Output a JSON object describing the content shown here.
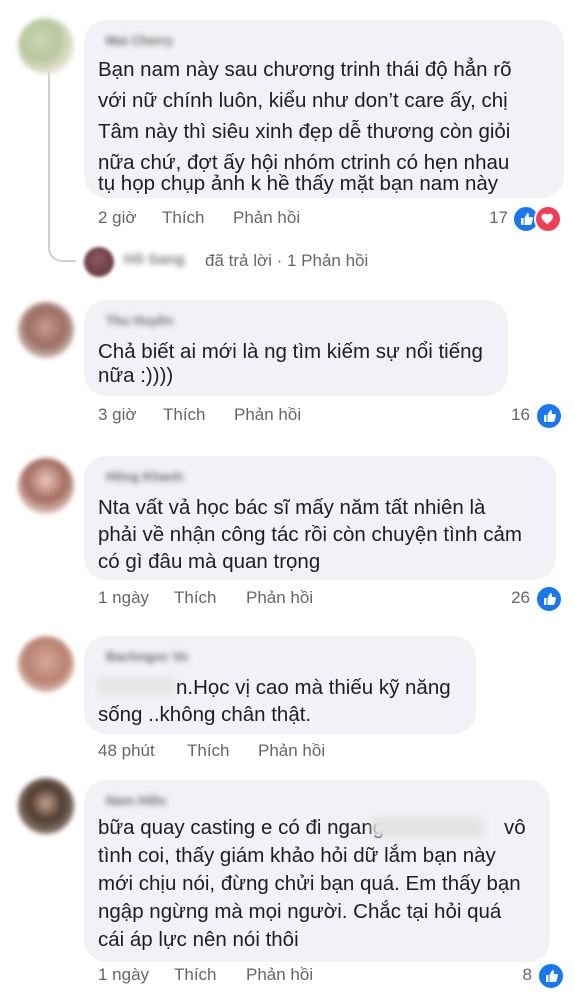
{
  "comments": [
    {
      "author": "Mai Cherry",
      "lines": [
        "Bạn nam này sau chương trinh thái độ hẳn rõ",
        "với nữ chính luôn, kiểu như don’t care ấy, chị",
        "Tâm này thì siêu xinh đẹp dễ thương còn giỏi",
        "nữa chứ, đợt ấy hội nhóm ctrinh có hẹn nhau",
        "tụ họp chụp ảnh k hề thấy mặt bạn nam này"
      ],
      "time": "2 giờ",
      "like_label": "Thích",
      "reply_label": "Phản hồi",
      "reaction_count": "17",
      "reactions": [
        "like-icon",
        "love-icon"
      ]
    },
    {
      "author": "Thu Huyền",
      "lines": [
        "Chả biết ai mới là ng tìm kiếm sự nổi tiếng",
        "nữa :))))"
      ],
      "time": "3 giờ",
      "like_label": "Thích",
      "reply_label": "Phản hồi",
      "reaction_count": "16",
      "reactions": [
        "like-icon"
      ]
    },
    {
      "author": "Hồng Khanh",
      "lines": [
        "Nta vất vả học bác sĩ mấy năm tất nhiên là",
        "phải về nhận công tác rồi còn chuyện tình cảm",
        "có gì đâu mà quan trọng"
      ],
      "time": "1 ngày",
      "like_label": "Thích",
      "reply_label": "Phản hồi",
      "reaction_count": "26",
      "reactions": [
        "like-icon"
      ]
    },
    {
      "author": "Bachngoc Vo",
      "lines": [
        "n.Học vị cao mà thiếu kỹ năng",
        "sống ..không chân thật."
      ],
      "time": "48 phút",
      "like_label": "Thích",
      "reply_label": "Phản hồi"
    },
    {
      "author": "Nam Hiền",
      "lines": [
        "bữa quay casting e có đi ngang",
        "vô",
        "tình coi, thấy giám khảo hỏi dữ lắm bạn này",
        "mới chịu nói, đừng chửi bạn quá. Em thấy bạn",
        "ngập ngừng mà mọi người. Chắc tại hỏi quá",
        "cái áp lực nên nói thôi"
      ],
      "time": "1 ngày",
      "like_label": "Thích",
      "reply_label": "Phản hồi",
      "reaction_count": "8",
      "reactions": [
        "like-icon"
      ]
    }
  ],
  "reply_summary": {
    "author": "Hồ Sang",
    "text": "đã trả lời · 1 Phản hồi"
  },
  "colors": {
    "bubble": "#f0f2f5",
    "meta": "#65676b",
    "like": "#1877f2",
    "love": "#f33e58"
  }
}
